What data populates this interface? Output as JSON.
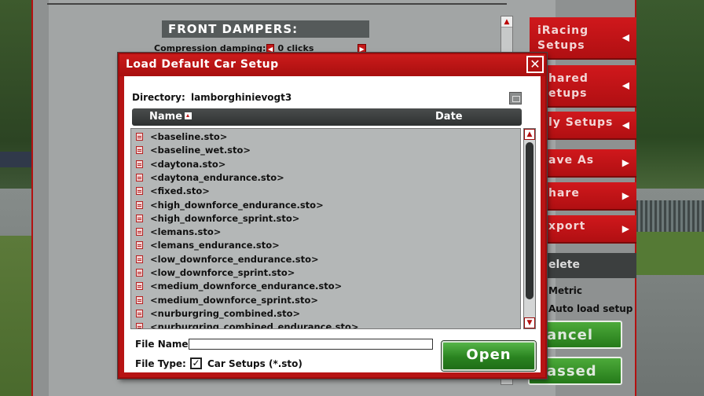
{
  "background": {
    "setup_window": {
      "section_title": "FRONT DAMPERS:",
      "compression_label": "Compression damping:",
      "compression_value": "0 clicks"
    },
    "side_menu": {
      "items": [
        {
          "label": "iRacing Setups",
          "arrow": "◀"
        },
        {
          "label": "hared etups",
          "arrow": "◀"
        },
        {
          "label": "ly Setups",
          "arrow": "◀"
        },
        {
          "label": "ave As",
          "arrow": "▶"
        },
        {
          "label": "hare",
          "arrow": "▶"
        },
        {
          "label": "xport",
          "arrow": "▶"
        }
      ],
      "delete_label": "elete",
      "option_metric": "Metric",
      "option_auto_load": "Auto load setup",
      "cancel_label": "ancel",
      "passed_label": "assed"
    }
  },
  "dialog": {
    "title": "Load Default Car Setup",
    "close_glyph": "✕",
    "directory_label": "Directory:",
    "directory_value": "lamborghinievogt3",
    "columns": {
      "name": "Name",
      "date": "Date"
    },
    "files": [
      "<baseline.sto>",
      "<baseline_wet.sto>",
      "<daytona.sto>",
      "<daytona_endurance.sto>",
      "<fixed.sto>",
      "<high_downforce_endurance.sto>",
      "<high_downforce_sprint.sto>",
      "<lemans.sto>",
      "<lemans_endurance.sto>",
      "<low_downforce_endurance.sto>",
      "<low_downforce_sprint.sto>",
      "<medium_downforce_endurance.sto>",
      "<medium_downforce_sprint.sto>",
      "<nurburgring_combined.sto>",
      "<nurburgring_combined_endurance.sto>"
    ],
    "file_name_label": "File Name:",
    "file_name_value": "",
    "file_type_label": "File Type:",
    "file_type_checked": "✓",
    "file_type_value": "Car Setups (*.sto)",
    "open_label": "Open"
  },
  "colors": {
    "accent_red": "#c41818",
    "button_green": "#2a8320",
    "header_dark": "#2e3131"
  }
}
